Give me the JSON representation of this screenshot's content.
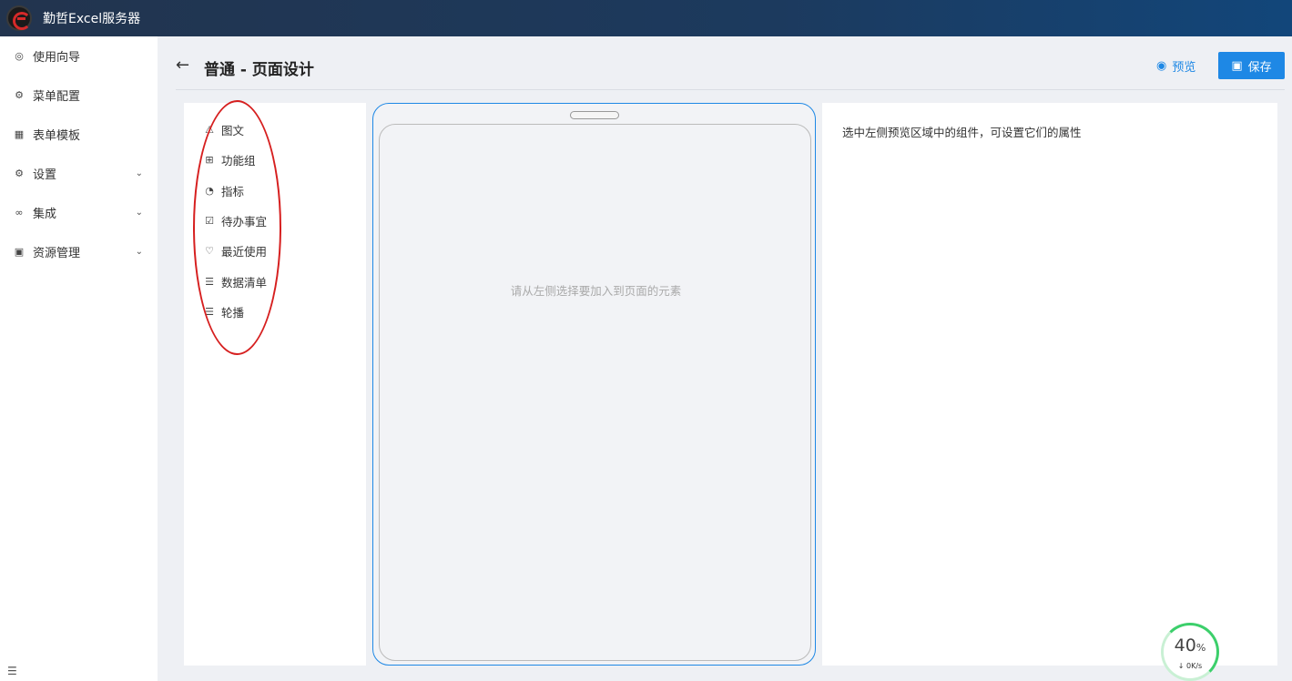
{
  "app": {
    "title": "勤哲Excel服务器"
  },
  "sidebar": {
    "items": [
      {
        "label": "使用向导",
        "icon": "compass-icon",
        "glyph": "◎",
        "chevron": false
      },
      {
        "label": "菜单配置",
        "icon": "menu-config-icon",
        "glyph": "⚙",
        "chevron": false
      },
      {
        "label": "表单模板",
        "icon": "table-icon",
        "glyph": "▦",
        "chevron": false
      },
      {
        "label": "设置",
        "icon": "gear-icon",
        "glyph": "⚙",
        "chevron": true
      },
      {
        "label": "集成",
        "icon": "link-icon",
        "glyph": "∞",
        "chevron": true
      },
      {
        "label": "资源管理",
        "icon": "folder-icon",
        "glyph": "▣",
        "chevron": true
      }
    ],
    "chevron_glyph": "⌄",
    "collapse_glyph": "☰"
  },
  "header": {
    "back_glyph": "←",
    "title": "普通 - 页面设计",
    "preview_label": "预览",
    "save_label": "保存"
  },
  "components": {
    "items": [
      {
        "label": "图文",
        "glyph": "⚠"
      },
      {
        "label": "功能组",
        "glyph": "⊞"
      },
      {
        "label": "指标",
        "glyph": "◔"
      },
      {
        "label": "待办事宜",
        "glyph": "☑"
      },
      {
        "label": "最近使用",
        "glyph": "♡"
      },
      {
        "label": "数据清单",
        "glyph": "☰"
      },
      {
        "label": "轮播",
        "glyph": "☰"
      }
    ]
  },
  "canvas": {
    "empty_hint": "请从左侧选择要加入到页面的元素"
  },
  "properties": {
    "hint": "选中左侧预览区域中的组件，可设置它们的属性"
  },
  "network_widget": {
    "percent": "40",
    "percent_unit": "%",
    "speed": "0K/s"
  },
  "colors": {
    "accent": "#1e88e5",
    "annotation": "#d61f1f",
    "topbar": "#1c3a5e"
  }
}
